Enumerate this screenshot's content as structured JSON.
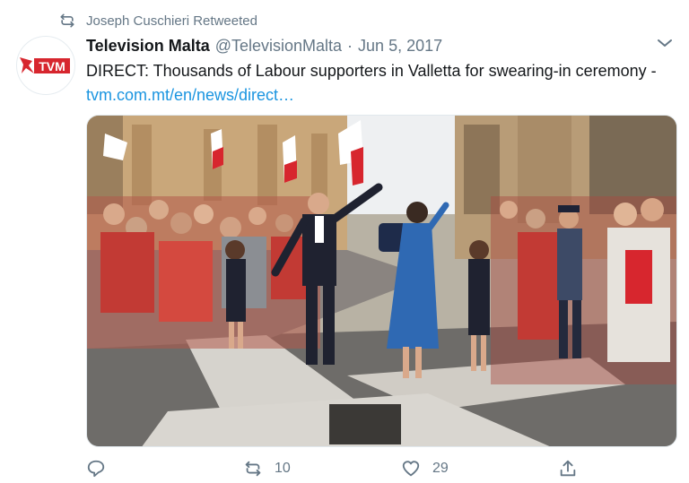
{
  "retweet_banner": {
    "icon": "retweet-icon",
    "text": "Joseph Cuschieri Retweeted"
  },
  "tweet": {
    "avatar_logo_text": "TVM",
    "author_name": "Television Malta",
    "handle": "@TelevisionMalta",
    "separator": "·",
    "date": "Jun 5, 2017",
    "text": "DIRECT: Thousands of Labour supporters in Valletta for swearing-in ceremony - ",
    "link": "tvm.com.mt/en/news/direct…",
    "menu_icon": "chevron-down-icon"
  },
  "actions": {
    "reply": {
      "icon": "reply-icon",
      "count": ""
    },
    "retweet": {
      "icon": "retweet-icon",
      "count": "10"
    },
    "like": {
      "icon": "heart-icon",
      "count": "29"
    },
    "share": {
      "icon": "share-icon",
      "count": ""
    }
  },
  "colors": {
    "text_primary": "#14171a",
    "text_secondary": "#657786",
    "link": "#1b95e0",
    "border": "#e1e8ed",
    "brand_red": "#d7262e"
  }
}
